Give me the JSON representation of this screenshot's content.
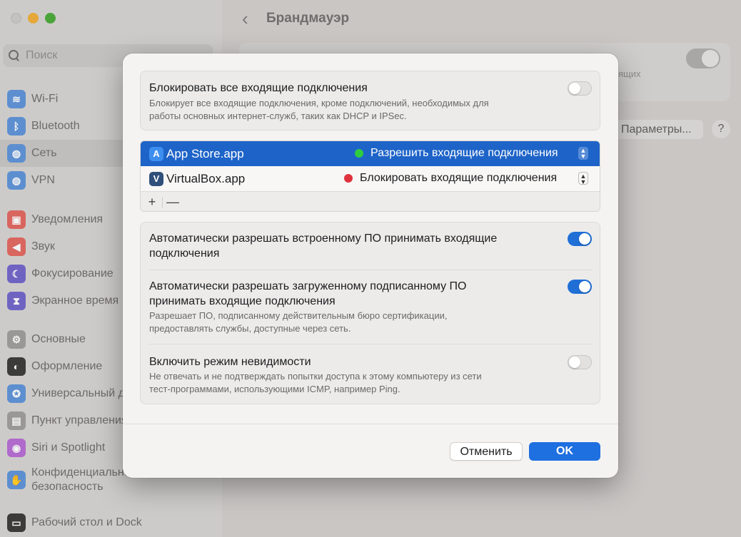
{
  "sidebar": {
    "search_placeholder": "Поиск",
    "items": [
      {
        "label": "Wi-Fi",
        "icon": "wifi-icon",
        "color": "#5d8fd0"
      },
      {
        "label": "Bluetooth",
        "icon": "bluetooth-icon",
        "color": "#5d8fd0"
      },
      {
        "label": "Сеть",
        "icon": "network-icon",
        "color": "#5d8fd0"
      },
      {
        "label": "VPN",
        "icon": "vpn-icon",
        "color": "#5d8fd0"
      },
      {
        "label": "Уведомления",
        "icon": "notifications-icon",
        "color": "#d9655f"
      },
      {
        "label": "Звук",
        "icon": "sound-icon",
        "color": "#d9655f"
      },
      {
        "label": "Фокусирование",
        "icon": "focus-icon",
        "color": "#6f63c2"
      },
      {
        "label": "Экранное время",
        "icon": "screen-time-icon",
        "color": "#6f63c2"
      },
      {
        "label": "Основные",
        "icon": "general-icon",
        "color": "#9a9896"
      },
      {
        "label": "Оформление",
        "icon": "appearance-icon",
        "color": "#3d3b39"
      },
      {
        "label": "Универсальный доступ",
        "icon": "accessibility-icon",
        "color": "#5d8fd0"
      },
      {
        "label": "Пункт управления",
        "icon": "control-center-icon",
        "color": "#9a9896"
      },
      {
        "label": "Siri и Spotlight",
        "icon": "siri-icon",
        "color": "#b06acb"
      },
      {
        "label": "Конфиденциальность и безопасность",
        "icon": "privacy-icon",
        "color": "#5d8fd0"
      },
      {
        "label": "Рабочий стол и Dock",
        "icon": "desktop-dock-icon",
        "color": "#3d3b39"
      }
    ]
  },
  "main": {
    "title": "Брандмауэр",
    "bg_small_text": "ящих",
    "params_button": "Параметры...",
    "help_button": "?"
  },
  "dialog": {
    "block_all": {
      "title": "Блокировать все входящие подключения",
      "desc_line1": "Блокирует все входящие подключения, кроме подключений, необходимых для",
      "desc_line2": "работы основных интернет-служб, таких как DHCP и IPSec.",
      "enabled": false
    },
    "apps": [
      {
        "name": "App Store.app",
        "action": "Разрешить входящие подключения",
        "status_color": "#2ecc40",
        "selected": true
      },
      {
        "name": "VirtualBox.app",
        "action": "Блокировать входящие подключения",
        "status_color": "#e0323c",
        "selected": false
      }
    ],
    "list_add": "+",
    "list_remove": "—",
    "auto_builtin": {
      "title_line1": "Автоматически разрешать встроенному ПО принимать входящие",
      "title_line2": "подключения",
      "enabled": true
    },
    "auto_signed": {
      "title_line1": "Автоматически разрешать загруженному подписанному ПО",
      "title_line2": "принимать входящие подключения",
      "desc_line1": "Разрешает ПО, подписанному действительным бюро сертификации,",
      "desc_line2": "предоставлять службы, доступные через сеть.",
      "enabled": true
    },
    "stealth": {
      "title": "Включить режим невидимости",
      "desc_line1": "Не отвечать и не подтверждать попытки доступа к этому компьютеру из сети",
      "desc_line2": "тест-программами, использующими ICMP, например Ping.",
      "enabled": false
    },
    "cancel_label": "Отменить",
    "ok_label": "OK"
  }
}
